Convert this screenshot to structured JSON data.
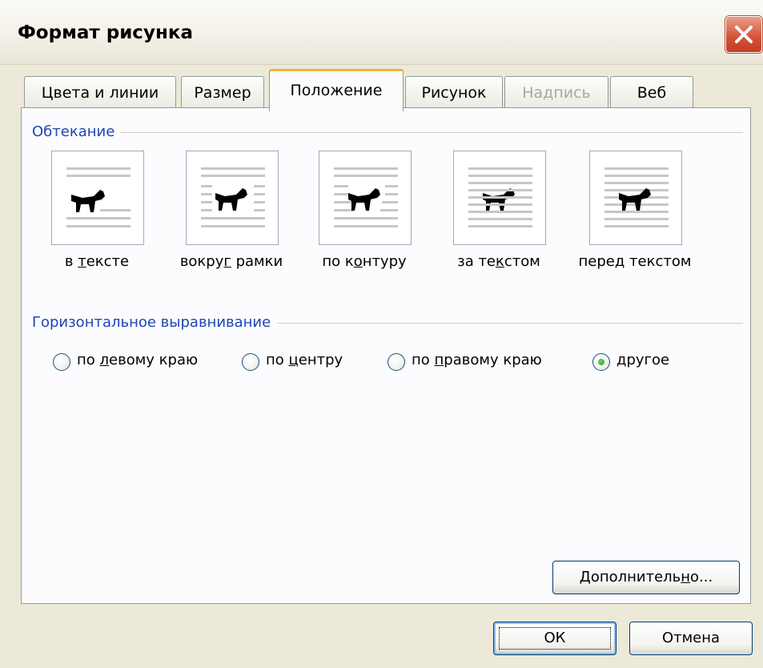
{
  "window": {
    "title": "Формат рисунка"
  },
  "tabs": [
    {
      "label": "Цвета и линии",
      "state": "normal"
    },
    {
      "label": "Размер",
      "state": "normal"
    },
    {
      "label": "Положение",
      "state": "active"
    },
    {
      "label": "Рисунок",
      "state": "normal"
    },
    {
      "label": "Надпись",
      "state": "disabled"
    },
    {
      "label": "Веб",
      "state": "normal"
    }
  ],
  "wrapping": {
    "group_label": "Обтекание",
    "options": [
      {
        "pre": "в ",
        "key": "т",
        "post": "ексте",
        "icon": "wrap-in-line-icon"
      },
      {
        "pre": "вокру",
        "key": "г",
        "post": " рамки",
        "icon": "wrap-square-icon"
      },
      {
        "pre": "по к",
        "key": "о",
        "post": "нтуру",
        "icon": "wrap-tight-icon"
      },
      {
        "pre": "за те",
        "key": "к",
        "post": "стом",
        "icon": "wrap-behind-text-icon"
      },
      {
        "pre": "пере",
        "key": "д",
        "post": " текстом",
        "icon": "wrap-in-front-icon"
      }
    ]
  },
  "alignment": {
    "group_label": "Горизонтальное выравнивание",
    "options": [
      {
        "pre": "по ",
        "key": "л",
        "post": "евому краю",
        "checked": false
      },
      {
        "pre": "по ",
        "key": "ц",
        "post": "ентру",
        "checked": false
      },
      {
        "pre": "по ",
        "key": "п",
        "post": "равому краю",
        "checked": false
      },
      {
        "pre": "",
        "key": "д",
        "post": "ругое",
        "checked": true
      }
    ]
  },
  "buttons": {
    "advanced": {
      "pre": "Дополнитель",
      "key": "н",
      "post": "о..."
    },
    "ok": "ОК",
    "cancel": "Отмена"
  },
  "colors": {
    "accent_tab": "#f2b03d",
    "group_label": "#1e46b4",
    "close": "#d5553c"
  }
}
